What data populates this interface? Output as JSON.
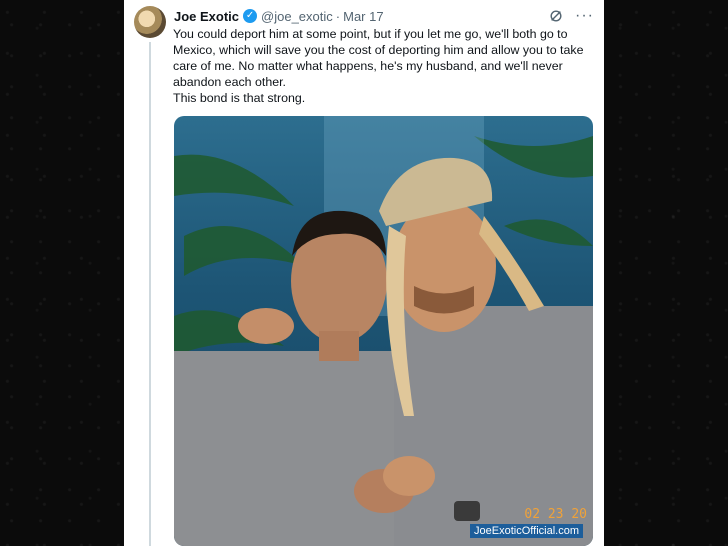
{
  "tweet": {
    "author_name": "Joe Exotic",
    "handle": "@joe_exotic",
    "separator": "·",
    "date": "Mar 17",
    "paragraphs": [
      "You could deport him at some point, but if you let me go, we'll both go to Mexico, which will save you the cost of deporting him and allow you to take care of me. No matter what happens, he's my husband, and we'll never abandon each other.",
      "This bond is that strong."
    ],
    "more_glyph": "···",
    "verified_glyph": "✓"
  },
  "photo": {
    "watermark": "JoeExoticOfficial.com",
    "datestamp": "02 23 20"
  }
}
